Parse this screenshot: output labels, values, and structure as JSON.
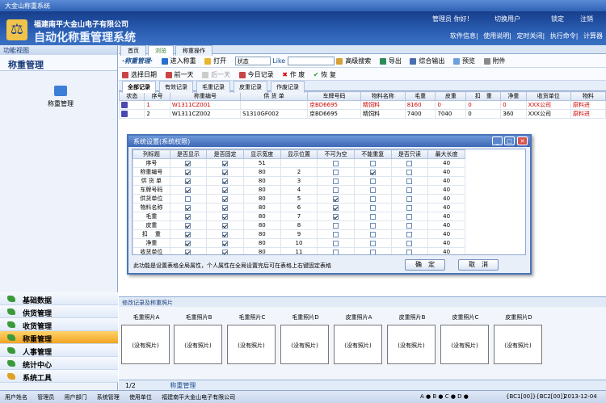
{
  "window": {
    "title": "大金山称重系统"
  },
  "banner": {
    "company": "福建南平大金山电子有限公司",
    "system": "自动化称重管理系统",
    "logo_char": "⚖",
    "user_label": "管理员 你好！",
    "switch_user": "切换用户",
    "lock": "锁定",
    "exit": "注销",
    "menu": [
      "软件信息",
      "使用说明",
      "定时关闭",
      "执行命令",
      "计算器"
    ]
  },
  "sidebar": {
    "header": "功能视图",
    "title": "称重管理",
    "module": "称重管理",
    "nav": [
      "基础数据",
      "供货管理",
      "收货管理",
      "称重管理",
      "人事管理",
      "统计中心",
      "系统工具"
    ],
    "active": "称重管理"
  },
  "tabs": [
    "首页",
    "浏览",
    "称重操作"
  ],
  "toolbar": {
    "title": "·称重管理·",
    "enter": "进入称重",
    "open": "打开",
    "status_select": "状态",
    "like": "Like",
    "advanced": "高级搜索",
    "export": "导出",
    "print": "综合输出",
    "preview": "预览",
    "attach": "附件"
  },
  "toolbar2": {
    "date": "选择日期",
    "prev": "前一天",
    "next": "后一天",
    "today": "今日记录",
    "void": "作 废",
    "restore": "恢 复"
  },
  "subtabs": [
    "全部记录",
    "有效记录",
    "毛重记录",
    "皮重记录",
    "作废记录"
  ],
  "table": {
    "headers": [
      "状态",
      "序号",
      "称重编号",
      "供 货 单",
      "车牌号码",
      "物料名称",
      "毛重",
      "皮重",
      "扣　重",
      "净重",
      "收货单位",
      "物料"
    ],
    "rows": [
      {
        "no": "1",
        "code": "W1311CZ001",
        "supply": "",
        "plate": "京BD6695",
        "material": "精饲料",
        "gross": "8160",
        "tare": "0",
        "deduct": "0",
        "net": "0",
        "receiver": "XXX公司",
        "mat2": "原料进"
      },
      {
        "no": "2",
        "code": "W1311CZ002",
        "supply": "S1310GF002",
        "plate": "京BD6695",
        "material": "精饲料",
        "gross": "7400",
        "tare": "7040",
        "deduct": "0",
        "net": "360",
        "receiver": "XXX公司",
        "mat2": "原料进"
      }
    ]
  },
  "dialog": {
    "title": "系统设置(系统权限)",
    "headers": [
      "列标题",
      "是否显示",
      "是否固定",
      "显示宽度",
      "显示位置",
      "不可为空",
      "不能重复",
      "是否只读",
      "最大长度"
    ],
    "rows": [
      {
        "name": "序号",
        "show": true,
        "fix": true,
        "width": "51",
        "pos": "",
        "notnull": false,
        "unique": false,
        "ro": false,
        "max": "40"
      },
      {
        "name": "称重编号",
        "show": true,
        "fix": true,
        "width": "80",
        "pos": "2",
        "notnull": false,
        "unique": true,
        "ro": false,
        "max": "40"
      },
      {
        "name": "供 货 单",
        "show": true,
        "fix": true,
        "width": "80",
        "pos": "3",
        "notnull": false,
        "unique": false,
        "ro": false,
        "max": "40"
      },
      {
        "name": "车牌号码",
        "show": true,
        "fix": true,
        "width": "80",
        "pos": "4",
        "notnull": false,
        "unique": false,
        "ro": false,
        "max": "40"
      },
      {
        "name": "供货单位",
        "show": false,
        "fix": true,
        "width": "80",
        "pos": "5",
        "notnull": true,
        "unique": false,
        "ro": false,
        "max": "40"
      },
      {
        "name": "物料名称",
        "show": true,
        "fix": true,
        "width": "80",
        "pos": "6",
        "notnull": true,
        "unique": false,
        "ro": false,
        "max": "40"
      },
      {
        "name": "毛重",
        "show": true,
        "fix": true,
        "width": "80",
        "pos": "7",
        "notnull": true,
        "unique": false,
        "ro": false,
        "max": "40"
      },
      {
        "name": "皮重",
        "show": true,
        "fix": true,
        "width": "80",
        "pos": "8",
        "notnull": false,
        "unique": false,
        "ro": false,
        "max": "40"
      },
      {
        "name": "扣　 重",
        "show": true,
        "fix": true,
        "width": "80",
        "pos": "9",
        "notnull": false,
        "unique": false,
        "ro": false,
        "max": "40"
      },
      {
        "name": "净重",
        "show": true,
        "fix": true,
        "width": "80",
        "pos": "10",
        "notnull": false,
        "unique": false,
        "ro": false,
        "max": "40"
      },
      {
        "name": "收货单位",
        "show": true,
        "fix": true,
        "width": "80",
        "pos": "11",
        "notnull": false,
        "unique": false,
        "ro": false,
        "max": "40"
      }
    ],
    "note": "此功能是设置表格全局属性，个人属性在全局设置完后可在表格上右键固定表格",
    "ok": "确　定",
    "cancel": "取　消"
  },
  "photos": {
    "header": "修改记录及称重照片",
    "labels": [
      "毛重照片A",
      "毛重照片B",
      "毛重照片C",
      "毛重照片D",
      "皮重照片A",
      "皮重照片B",
      "皮重照片C",
      "皮重照片D"
    ],
    "empty": "(没有照片)"
  },
  "pager": {
    "page": "1/2",
    "module": "称重管理"
  },
  "status": {
    "items": [
      "用户姓名",
      "管理员",
      "用户部门",
      "系统管理",
      "使用单位",
      "福建南平大金山电子有限公司"
    ],
    "tail": "A ● B ● C ● D ●",
    "ports": "{BC1[00]}{BC2[00]}",
    "date": "2013-12-04"
  }
}
